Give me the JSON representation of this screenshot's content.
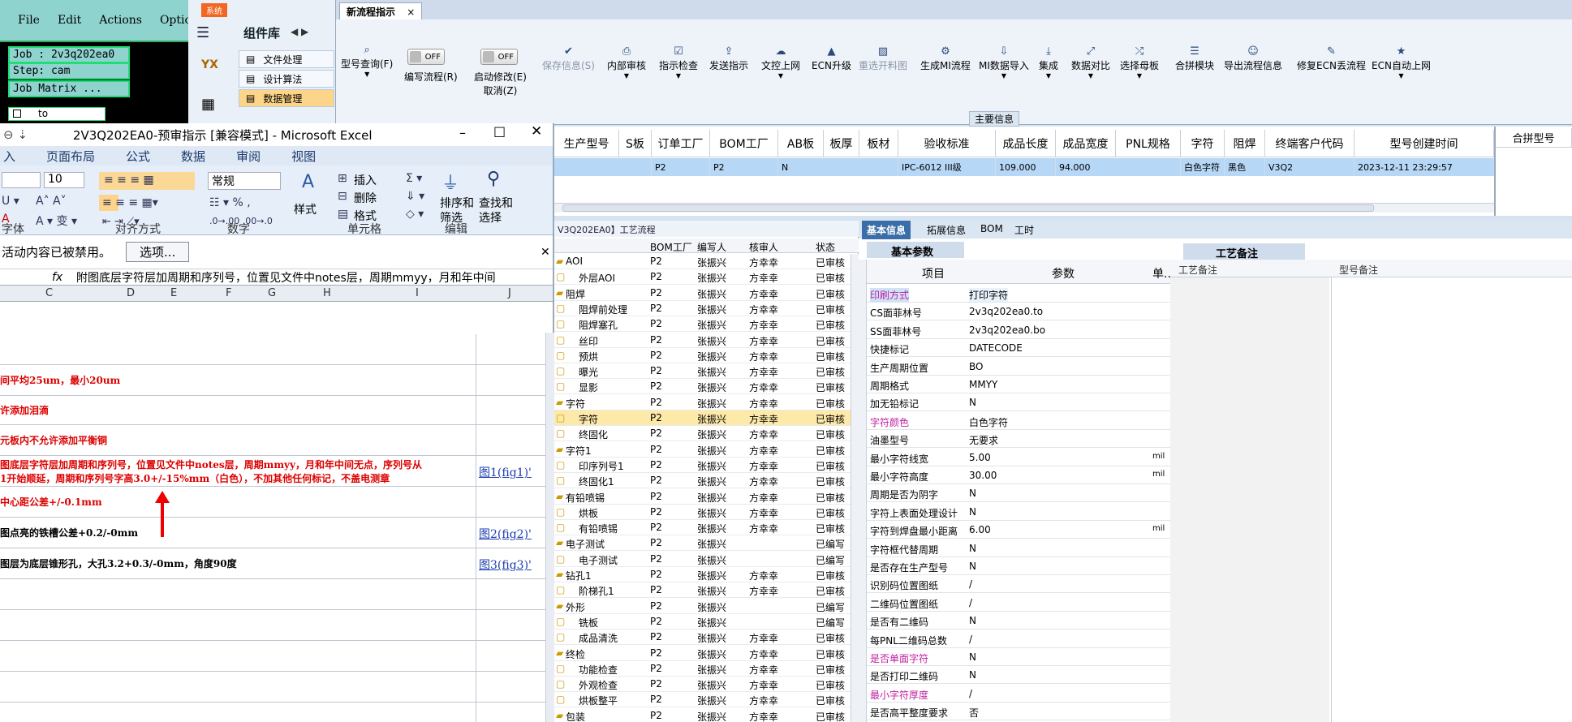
{
  "cam": {
    "menu": [
      "File",
      "Edit",
      "Actions",
      "Options"
    ],
    "job": "Job : 2v3q202ea0",
    "step": "Step: cam",
    "matrix": "Job Matrix ...",
    "to": "to"
  },
  "complib": {
    "system_btn": "系统",
    "title": "组件库",
    "items": [
      "文件处理",
      "设计算法",
      "数据管理"
    ],
    "icon_label": "YX"
  },
  "tab": {
    "label": "新流程指示",
    "close": "×"
  },
  "ribbon": {
    "buttons": [
      {
        "label": "型号查询(F)",
        "icon": "search-icon"
      },
      {
        "label": "编写流程(R)",
        "icon": "toggle"
      },
      {
        "label": "启动修改(E)",
        "sub": "取消(Z)",
        "icon": "toggle"
      },
      {
        "label": "保存信息(S)",
        "icon": "check-icon",
        "disabled": true
      },
      {
        "label": "内部审核",
        "icon": "printer-icon"
      },
      {
        "label": "指示检查",
        "icon": "check-icon"
      },
      {
        "label": "发送指示",
        "icon": "upload-icon"
      },
      {
        "label": "文控上网",
        "icon": "cloud-icon"
      },
      {
        "label": "ECN升级",
        "icon": "a-icon"
      },
      {
        "label": "重选开料图",
        "icon": "image-icon",
        "disabled": true
      },
      {
        "label": "生成MI流程",
        "icon": "share-icon"
      },
      {
        "label": "MI数据导入",
        "icon": "import-icon"
      },
      {
        "label": "集成",
        "icon": "download-icon"
      },
      {
        "label": "数据对比",
        "icon": "compare-icon"
      },
      {
        "label": "选择母板",
        "icon": "shuffle-icon"
      },
      {
        "label": "合拼模块",
        "icon": "list-icon"
      },
      {
        "label": "导出流程信息",
        "icon": "smile-icon"
      },
      {
        "label": "修复ECN丢流程",
        "icon": "wrench-icon"
      },
      {
        "label": "ECN自动上网",
        "icon": "star-icon"
      }
    ],
    "toggle_off": "OFF",
    "section_label": "主要信息"
  },
  "table": {
    "headers": [
      "生产型号",
      "S板",
      "订单工厂",
      "BOM工厂",
      "AB板",
      "板厚",
      "板材",
      "验收标准",
      "成品长度",
      "成品宽度",
      "PNL规格",
      "字符",
      "阻焊",
      "终端客户代码",
      "型号创建时间",
      "合拼型号"
    ],
    "row": [
      "",
      "",
      "P2",
      "P2",
      "N",
      "",
      "",
      "IPC-6012 III级",
      "109.000",
      "94.000",
      "",
      "白色字符",
      "黑色",
      "V3Q2",
      "2023-12-11 23:29:57"
    ]
  },
  "excel": {
    "title": "2V3Q202EA0-预审指示 [兼容模式] - Microsoft Excel",
    "tabs": [
      "入",
      "页面布局",
      "公式",
      "数据",
      "审阅",
      "视图"
    ],
    "font_size": "10",
    "number_format": "常规",
    "group_labels": [
      "字体",
      "对齐方式",
      "数字",
      "单元格",
      "编辑"
    ],
    "style_label": "样式",
    "insert": "插入",
    "delete": "删除",
    "format": "格式",
    "sort": "排序和",
    "filter": "筛选",
    "find": "查找和",
    "select": "选择",
    "msg": "活动内容已被禁用。",
    "options_btn": "选项...",
    "formula": "附图底层字符层加周期和序列号，位置见文件中notes层，周期mmyy，月和年中间",
    "fx": "fx",
    "cols": [
      "C",
      "D",
      "E",
      "F",
      "G",
      "H",
      "I",
      "J"
    ],
    "rows": [
      {
        "text": "",
        "link": ""
      },
      {
        "text": "间平均25um，最小20um",
        "link": "",
        "red": true
      },
      {
        "text": "许添加泪滴",
        "link": "",
        "red": true
      },
      {
        "text": "元板内不允许添加平衡铜",
        "link": "",
        "red": true
      },
      {
        "text": "图底层字符层加周期和序列号，位置见文件中notes层，周期mmyy，月和年中间无点，序列号从",
        "text2": "1开始顺延，周期和序列号字高3.0+/-15%mm（白色），不加其他任何标记，不盖电测章",
        "link": "图1(fig1)'",
        "red": true
      },
      {
        "text": "中心距公差+/-0.1mm",
        "link": "",
        "red": true
      },
      {
        "text": "图点亮的铁槽公差+0.2/-0mm",
        "link": "图2(fig2)'"
      },
      {
        "text": "图层为底层锥形孔，大孔3.2+0.3/-0mm，角度90度",
        "link": "图3(fig3)'"
      }
    ]
  },
  "process": {
    "title": "V3Q202EA0】工艺流程",
    "headers": [
      "BOM工厂",
      "编写人",
      "核审人",
      "状态"
    ],
    "rows": [
      [
        "AOI",
        "P2",
        "张振兴",
        "方幸幸",
        "已审核",
        0
      ],
      [
        "外层AOI",
        "P2",
        "张振兴",
        "方幸幸",
        "已审核",
        1
      ],
      [
        "阻焊",
        "P2",
        "张振兴",
        "方幸幸",
        "已审核",
        0
      ],
      [
        "阻焊前处理",
        "P2",
        "张振兴",
        "方幸幸",
        "已审核",
        1
      ],
      [
        "阻焊塞孔",
        "P2",
        "张振兴",
        "方幸幸",
        "已审核",
        1
      ],
      [
        "丝印",
        "P2",
        "张振兴",
        "方幸幸",
        "已审核",
        1
      ],
      [
        "预烘",
        "P2",
        "张振兴",
        "方幸幸",
        "已审核",
        1
      ],
      [
        "曝光",
        "P2",
        "张振兴",
        "方幸幸",
        "已审核",
        1
      ],
      [
        "显影",
        "P2",
        "张振兴",
        "方幸幸",
        "已审核",
        1
      ],
      [
        "字符",
        "P2",
        "张振兴",
        "方幸幸",
        "已审核",
        0
      ],
      [
        "字符",
        "P2",
        "张振兴",
        "方幸幸",
        "已审核",
        1
      ],
      [
        "终固化",
        "P2",
        "张振兴",
        "方幸幸",
        "已审核",
        1
      ],
      [
        "字符1",
        "P2",
        "张振兴",
        "方幸幸",
        "已审核",
        0
      ],
      [
        "印序列号1",
        "P2",
        "张振兴",
        "方幸幸",
        "已审核",
        1
      ],
      [
        "终固化1",
        "P2",
        "张振兴",
        "方幸幸",
        "已审核",
        1
      ],
      [
        "有铅喷锡",
        "P2",
        "张振兴",
        "方幸幸",
        "已审核",
        0
      ],
      [
        "烘板",
        "P2",
        "张振兴",
        "方幸幸",
        "已审核",
        1
      ],
      [
        "有铅喷锡",
        "P2",
        "张振兴",
        "方幸幸",
        "已审核",
        1
      ],
      [
        "电子测试",
        "P2",
        "张振兴",
        "",
        "已编写",
        0
      ],
      [
        "电子测试",
        "P2",
        "张振兴",
        "",
        "已编写",
        1
      ],
      [
        "钻孔1",
        "P2",
        "张振兴",
        "方幸幸",
        "已审核",
        0
      ],
      [
        "阶梯孔1",
        "P2",
        "张振兴",
        "方幸幸",
        "已审核",
        1
      ],
      [
        "外形",
        "P2",
        "张振兴",
        "",
        "已编写",
        0
      ],
      [
        "铣板",
        "P2",
        "张振兴",
        "",
        "已编写",
        1
      ],
      [
        "成品清洗",
        "P2",
        "张振兴",
        "方幸幸",
        "已审核",
        1
      ],
      [
        "终检",
        "P2",
        "张振兴",
        "方幸幸",
        "已审核",
        0
      ],
      [
        "功能检查",
        "P2",
        "张振兴",
        "方幸幸",
        "已审核",
        1
      ],
      [
        "外观检查",
        "P2",
        "张振兴",
        "方幸幸",
        "已审核",
        1
      ],
      [
        "烘板整平",
        "P2",
        "张振兴",
        "方幸幸",
        "已审核",
        1
      ],
      [
        "包装",
        "P2",
        "张振兴",
        "方幸幸",
        "已审核",
        0
      ]
    ]
  },
  "params": {
    "tabs": [
      "基本信息",
      "拓展信息",
      "BOM",
      "工时"
    ],
    "sub_tab": "基本参数",
    "headers": [
      "项目",
      "参数",
      "单..."
    ],
    "rows": [
      [
        "印刷方式",
        "打印字符",
        "",
        true
      ],
      [
        "CS面菲林号",
        "2v3q202ea0.to",
        "",
        false
      ],
      [
        "SS面菲林号",
        "2v3q202ea0.bo",
        "",
        false
      ],
      [
        "快捷标记",
        "DATECODE",
        "",
        false
      ],
      [
        "生产周期位置",
        "BO",
        "",
        false
      ],
      [
        "周期格式",
        "MMYY",
        "",
        false
      ],
      [
        "加无铅标记",
        "N",
        "",
        false
      ],
      [
        "字符颜色",
        "白色字符",
        "",
        true
      ],
      [
        "油墨型号",
        "无要求",
        "",
        false
      ],
      [
        "最小字符线宽",
        "5.00",
        "mil",
        false
      ],
      [
        "最小字符高度",
        "30.00",
        "mil",
        false
      ],
      [
        "周期是否为阴字",
        "N",
        "",
        false
      ],
      [
        "字符上表面处理设计",
        "N",
        "",
        false
      ],
      [
        "字符到焊盘最小距离",
        "6.00",
        "mil",
        false
      ],
      [
        "字符框代替周期",
        "N",
        "",
        false
      ],
      [
        "是否存在生产型号",
        "N",
        "",
        false
      ],
      [
        "识别码位置图纸",
        "/",
        "",
        false
      ],
      [
        "二维码位置图纸",
        "/",
        "",
        false
      ],
      [
        "是否有二维码",
        "N",
        "",
        false
      ],
      [
        "每PNL二维码总数",
        "/",
        "",
        false
      ],
      [
        "是否单面字符",
        "N",
        "",
        true
      ],
      [
        "是否打印二维码",
        "N",
        "",
        false
      ],
      [
        "最小字符厚度",
        "/",
        "",
        true
      ],
      [
        "是否高平整度要求",
        "否",
        "",
        false
      ]
    ]
  },
  "notes": {
    "tab": "工艺备注",
    "col1": "工艺备注",
    "col2": "型号备注"
  }
}
